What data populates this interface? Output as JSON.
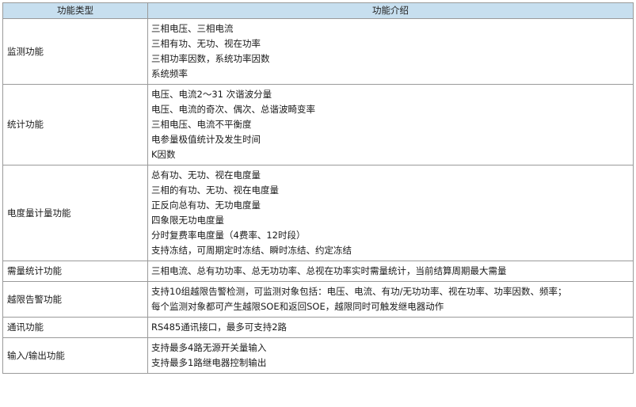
{
  "table": {
    "headers": [
      "功能类型",
      "功能介绍"
    ],
    "rows": [
      {
        "category": "监测功能",
        "lines": [
          "三相电压、三相电流",
          "三相有功、无功、视在功率",
          "三相功率因数，系统功率因数",
          "系统频率"
        ]
      },
      {
        "category": "统计功能",
        "lines": [
          "电压、电流2～31 次谐波分量",
          "电压、电流的奇次、偶次、总谐波畸变率",
          "三相电压、电流不平衡度",
          "电参量极值统计及发生时间",
          "K因数"
        ]
      },
      {
        "category": "电度量计量功能",
        "lines": [
          "总有功、无功、视在电度量",
          "三相的有功、无功、视在电度量",
          "正反向总有功、无功电度量",
          "四象限无功电度量",
          "分时复费率电度量（4费率、12时段）",
          "支持冻结，可周期定时冻结、瞬时冻结、约定冻结"
        ]
      },
      {
        "category": "需量统计功能",
        "lines": [
          "三相电流、总有功功率、总无功功率、总视在功率实时需量统计，当前结算周期最大需量"
        ]
      },
      {
        "category": "越限告警功能",
        "lines": [
          "支持10组越限告警检测，可监测对象包括：电压、电流、有功/无功功率、视在功率、功率因数、频率；",
          "每个监测对象都可产生越限SOE和返回SOE，越限同时可触发继电器动作"
        ]
      },
      {
        "category": "通讯功能",
        "lines": [
          "RS485通讯接口，最多可支持2路"
        ]
      },
      {
        "category": "输入/输出功能",
        "lines": [
          "支持最多4路无源开关量输入",
          "支持最多1路继电器控制输出"
        ]
      }
    ]
  }
}
